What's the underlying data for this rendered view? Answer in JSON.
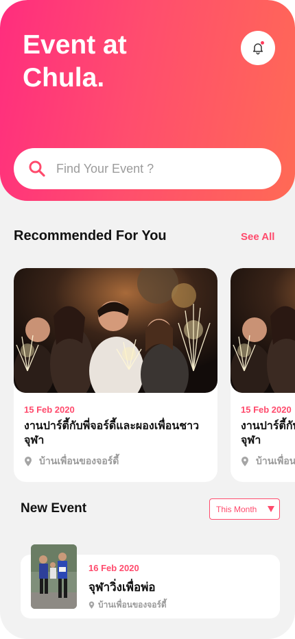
{
  "header": {
    "title": "Event at\nChula.",
    "gradient_start": "#ff2d7e",
    "gradient_end": "#ff6a55",
    "notification_icon": "bell-icon"
  },
  "search": {
    "placeholder": "Find Your Event ?",
    "value": "",
    "icon": "search-icon"
  },
  "recommended": {
    "title": "Recommended For You",
    "see_all_label": "See All",
    "cards": [
      {
        "date": "15 Feb 2020",
        "title": "งานปาร์ตี้กับพี่จอร์ดี้และผองเพื่อนชาวจุฬา",
        "location": "บ้านเพื่อนของจอร์ดี้",
        "image": "party-sparklers-photo"
      },
      {
        "date": "15 Feb 2020",
        "title": "งานปาร์ตี้กับพี่จอร์ดี้และผองเพื่อนชาวจุฬา",
        "location": "บ้านเพื่อนของจอร์ดี้",
        "image": "party-sparklers-photo"
      }
    ]
  },
  "new_event": {
    "title": "New Event",
    "filter_selected": "This Month",
    "events": [
      {
        "date": "16 Feb 2020",
        "title": "จุฬาวิ่งเพื่อพ่อ",
        "location": "บ้านเพื่อนของจอร์ดี้",
        "image": "marathon-runners-photo"
      }
    ]
  },
  "colors": {
    "accent": "#ff4a6c",
    "background": "#f2f2f2",
    "card": "#ffffff",
    "muted_text": "#9a9a9a"
  }
}
